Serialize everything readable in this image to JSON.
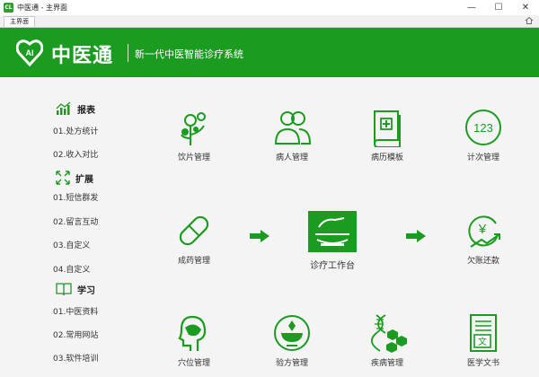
{
  "window": {
    "title": "中医通 - 主界面",
    "icon_text": "CL",
    "minimize": "—",
    "maximize": "☐",
    "close": "✕"
  },
  "tabs": [
    {
      "label": "主界面"
    }
  ],
  "header": {
    "logo_text": "AI",
    "brand": "中医通",
    "slogan": "新一代中医智能诊疗系统",
    "accent_color": "#1b9b20"
  },
  "sidebar": {
    "sections": [
      {
        "icon": "chart-icon",
        "title": "报表",
        "items": [
          "01.处方统计",
          "02.收入对比"
        ]
      },
      {
        "icon": "expand-icon",
        "title": "扩展",
        "items": [
          "01.短信群发",
          "02.留言互动",
          "03.自定义",
          "04.自定义"
        ]
      },
      {
        "icon": "book-icon",
        "title": "学习",
        "items": [
          "01.中医资料",
          "02.常用网站",
          "03.软件培训"
        ]
      }
    ]
  },
  "main": {
    "row1": [
      {
        "icon": "herb-icon",
        "label": "饮片管理"
      },
      {
        "icon": "patients-icon",
        "label": "病人管理"
      },
      {
        "icon": "medical-record-icon",
        "label": "病历模板"
      },
      {
        "icon": "counter-icon",
        "label": "计次管理",
        "icon_text": "123"
      }
    ],
    "row2": [
      {
        "icon": "pill-icon",
        "label": "成药管理"
      },
      {
        "icon": "workbench-icon",
        "label": "诊疗工作台"
      },
      {
        "icon": "yuan-repay-icon",
        "label": "欠账还款",
        "icon_text": "¥"
      }
    ],
    "row3": [
      {
        "icon": "acupoint-icon",
        "label": "穴位管理"
      },
      {
        "icon": "mortar-icon",
        "label": "验方管理"
      },
      {
        "icon": "dna-icon",
        "label": "疾病管理"
      },
      {
        "icon": "document-icon",
        "label": "医学文书",
        "icon_text": "文"
      }
    ]
  }
}
